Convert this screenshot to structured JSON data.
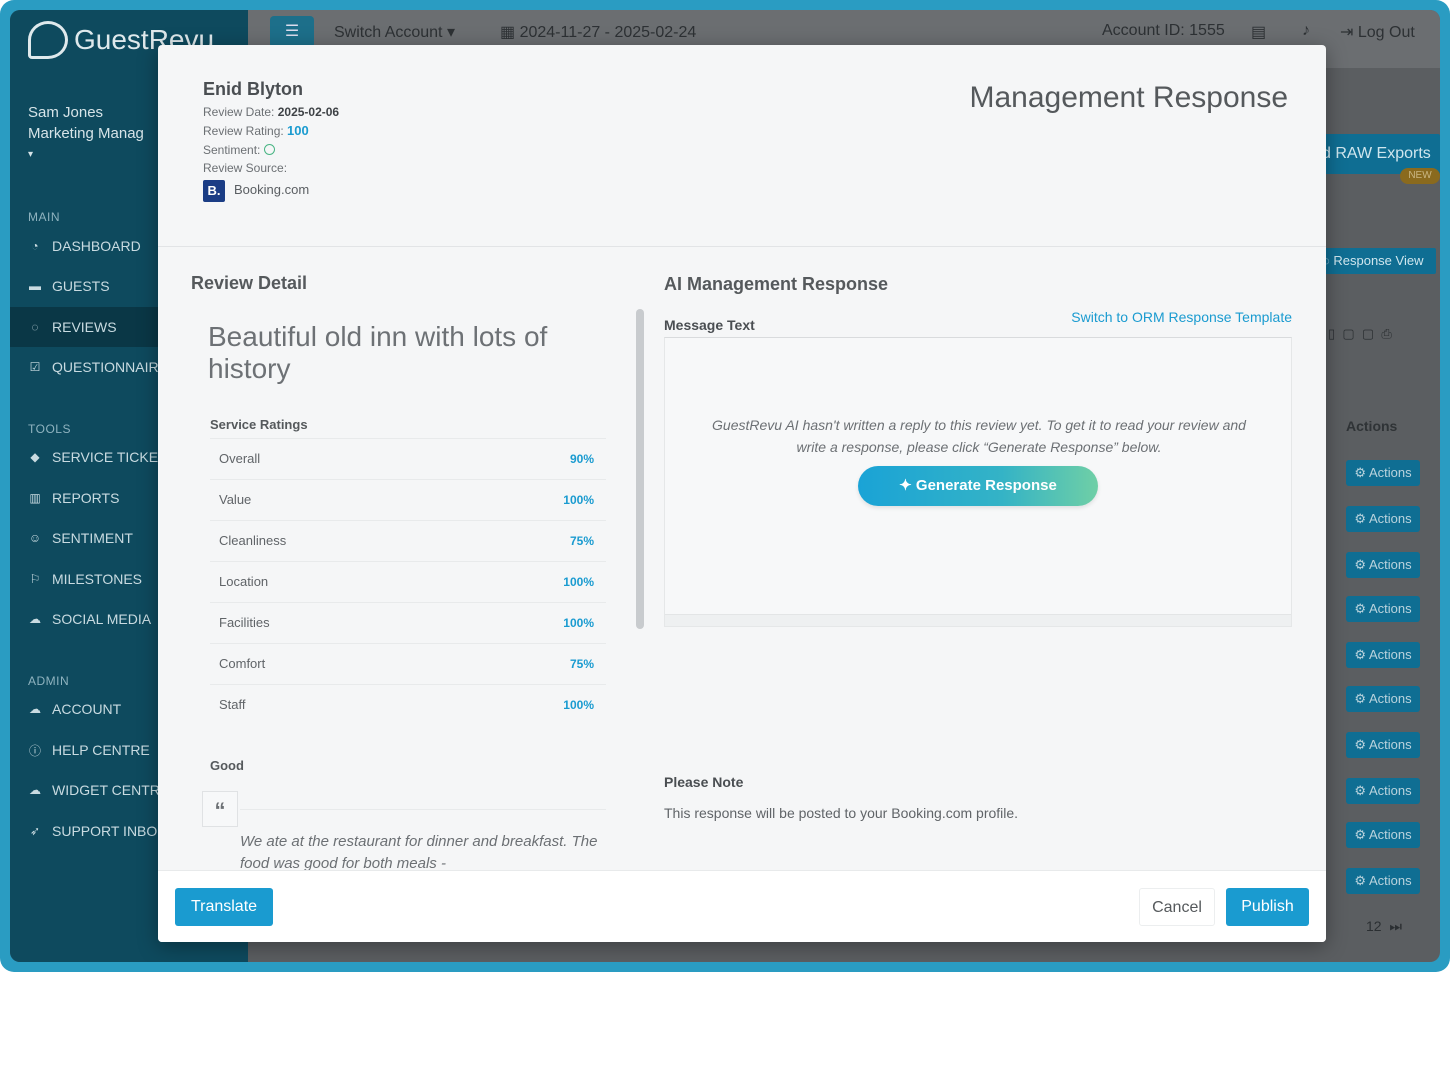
{
  "app": {
    "logo_text": "GuestRevu",
    "user_name": "Sam Jones",
    "user_role": "Marketing Manag",
    "topbar": {
      "switch_account": "Switch Account",
      "date_range": "2024-11-27 - 2025-02-24",
      "account_id": "Account ID: 1555",
      "logout": "Log Out"
    },
    "sections": {
      "main": "MAIN",
      "tools": "TOOLS",
      "admin": "ADMIN"
    },
    "nav_main": [
      "DASHBOARD",
      "GUESTS",
      "REVIEWS",
      "QUESTIONNAIR"
    ],
    "nav_tools": [
      "SERVICE TICKET",
      "REPORTS",
      "SENTIMENT",
      "MILESTONES",
      "SOCIAL MEDIA"
    ],
    "nav_admin": [
      "ACCOUNT",
      "HELP CENTRE",
      "WIDGET CENTR",
      "SUPPORT INBO"
    ],
    "background": {
      "raw_exports": "d RAW Exports",
      "new_badge": "NEW",
      "response_view": "Response View",
      "actions_header": "Actions",
      "action_label": "Actions",
      "page_last": "12"
    }
  },
  "modal": {
    "reviewer": "Enid Blyton",
    "review_date_label": "Review Date:",
    "review_date": "2025-02-06",
    "review_rating_label": "Review Rating:",
    "review_rating": "100",
    "sentiment_label": "Sentiment:",
    "review_source_label": "Review Source:",
    "source_logo": "B.",
    "source_name": "Booking.com",
    "title": "Management Response",
    "review_detail_title": "Review Detail",
    "review_headline": "Beautiful old inn with lots of history",
    "service_ratings_label": "Service Ratings",
    "ratings": [
      {
        "name": "Overall",
        "value": "90%"
      },
      {
        "name": "Value",
        "value": "100%"
      },
      {
        "name": "Cleanliness",
        "value": "75%"
      },
      {
        "name": "Location",
        "value": "100%"
      },
      {
        "name": "Facilities",
        "value": "100%"
      },
      {
        "name": "Comfort",
        "value": "75%"
      },
      {
        "name": "Staff",
        "value": "100%"
      }
    ],
    "good_label": "Good",
    "quote_text": "We ate at the restaurant for dinner and breakfast. The food was good for both meals -",
    "ai_title": "AI Management Response",
    "message_text_label": "Message Text",
    "orm_link": "Switch to ORM Response Template",
    "ai_placeholder": "GuestRevu AI hasn't written a reply to this review yet. To get it to read your review and write a response, please click “Generate Response” below.",
    "generate_button": "Generate Response",
    "please_note_label": "Please Note",
    "please_note_text": "This response will be posted to your Booking.com profile.",
    "translate_button": "Translate",
    "cancel_button": "Cancel",
    "publish_button": "Publish"
  }
}
